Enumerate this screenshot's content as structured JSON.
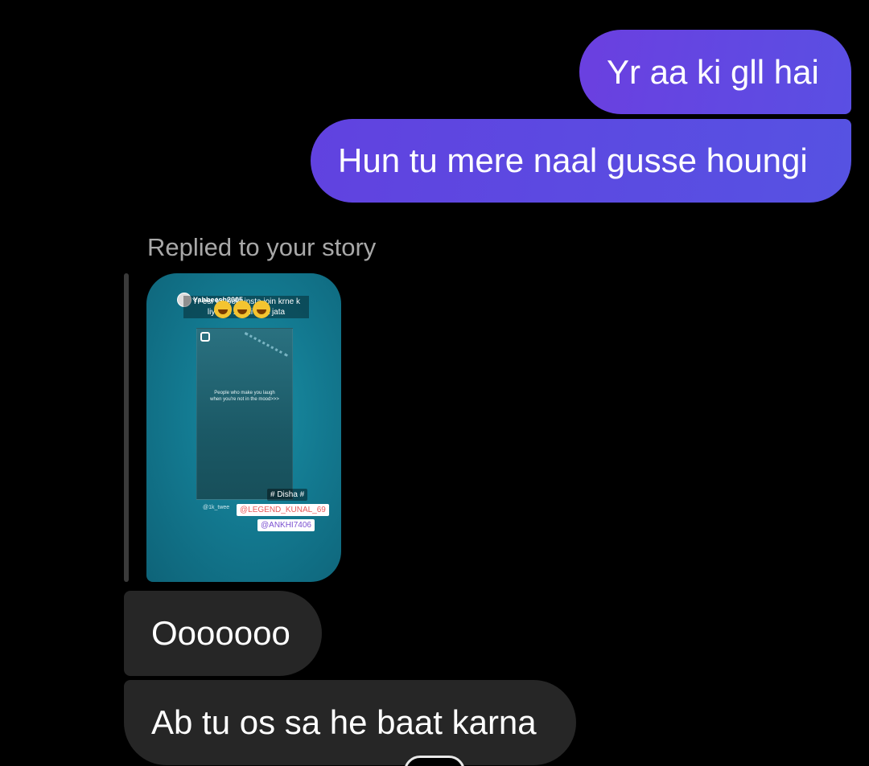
{
  "conversation": {
    "sent_messages": [
      {
        "text": "Yr aa ki gll hai"
      },
      {
        "text": "Hun tu mere naal gusse houngi"
      }
    ],
    "story_reply": {
      "label": "Replied to your story",
      "story": {
        "username": "Yahbeesh2005",
        "caption": "Yr esr ke bola insta join krne k liye ha ... nhi diya jata",
        "inner_text": "People who make you laugh when you're not in the mood>>>",
        "tags": {
          "disha": "# Disha #",
          "kunal": "@LEGEND_KUNAL_69",
          "ankhi": "@ANKHI7406",
          "tweet": "@1k_twee"
        },
        "emoji_icon": "laughing-emoji-icon"
      }
    },
    "received_messages": [
      {
        "text": "Ooooooo"
      },
      {
        "text": "Ab tu os sa he baat karna"
      }
    ]
  },
  "colors": {
    "background": "#000000",
    "sent_bubble": "#5f46e0",
    "received_bubble": "#262626",
    "reply_label": "#a8a8a8",
    "story_teal": "#137a91"
  }
}
